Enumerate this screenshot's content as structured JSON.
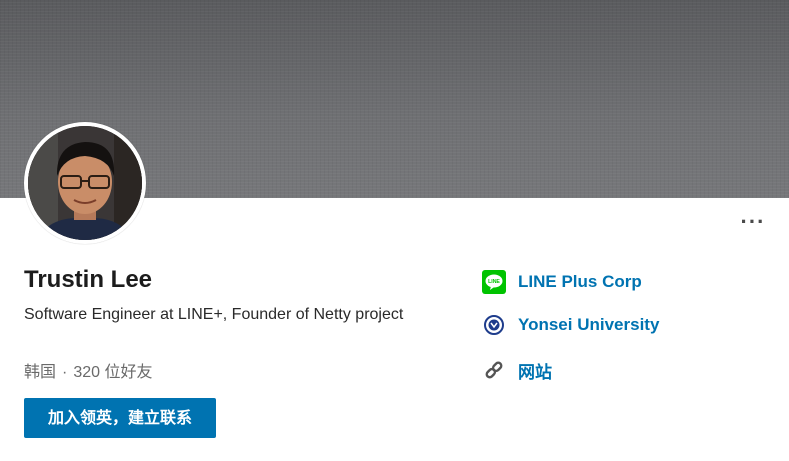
{
  "profile": {
    "name": "Trustin Lee",
    "headline": "Software Engineer at LINE+, Founder of Netty project",
    "location": "韩国",
    "separator": "·",
    "connections": "320 位好友",
    "connect_label": "加入领英，建立联系",
    "more_label": "···"
  },
  "sidebar": {
    "items": [
      {
        "label": "LINE Plus Corp",
        "icon": "line-logo-icon",
        "icon_color": "#00c300"
      },
      {
        "label": "Yonsei University",
        "icon": "university-seal-icon",
        "icon_color": "#1e3c8c"
      },
      {
        "label": "网站",
        "icon": "link-icon",
        "icon_color": "#555555"
      }
    ]
  },
  "colors": {
    "accent": "#0073b1",
    "banner": "#6d6e71"
  }
}
